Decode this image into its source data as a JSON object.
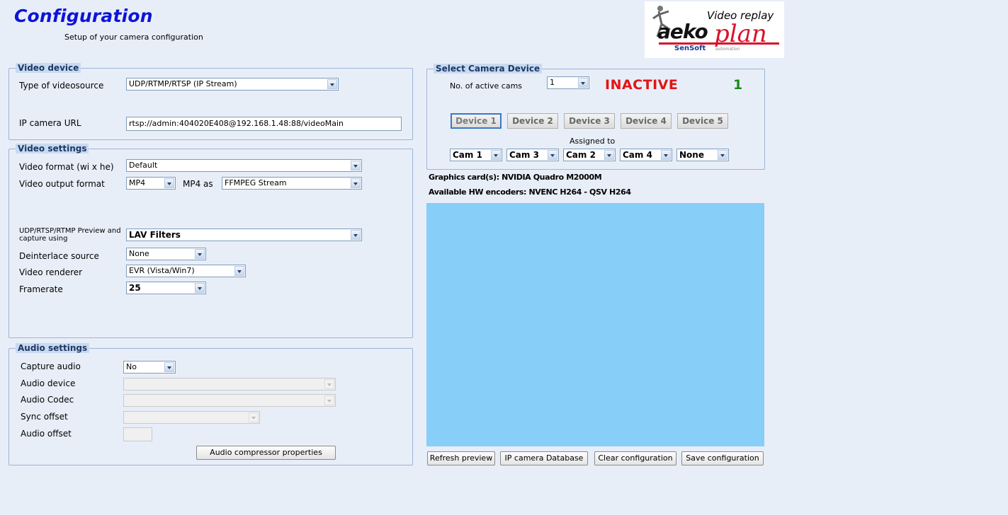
{
  "header": {
    "title": "Configuration",
    "subtitle": "Setup of your camera configuration"
  },
  "logo": {
    "title": "Video replay",
    "brand_a": "aeko",
    "brand_b": "plan",
    "sensoft": "SenSoft",
    "automation": "automation"
  },
  "video_device": {
    "group_label": "Video device",
    "type_label": "Type of videosource",
    "type_value": "UDP/RTMP/RTSP (IP Stream)",
    "url_label": "IP camera URL",
    "url_value": "rtsp://admin:404020E408@192.168.1.48:88/videoMain"
  },
  "video_settings": {
    "group_label": "Video settings",
    "format_label": "Video format (wi x he)",
    "format_value": "Default",
    "output_label": "Video output format",
    "output_value": "MP4",
    "mp4_as_label": "MP4 as",
    "mp4_as_value": "FFMPEG Stream",
    "preview_label_1": "UDP/RTSP/RTMP Preview and",
    "preview_label_2": "capture using",
    "preview_value": "LAV Filters",
    "deinterlace_label": "Deinterlace source",
    "deinterlace_value": "None",
    "renderer_label": "Video renderer",
    "renderer_value": "EVR (Vista/Win7)",
    "framerate_label": "Framerate",
    "framerate_value": "25"
  },
  "audio_settings": {
    "group_label": "Audio settings",
    "capture_label": "Capture audio",
    "capture_value": "No",
    "device_label": "Audio device",
    "codec_label": "Audio Codec",
    "sync_label": "Sync offset",
    "offset_label": "Audio offset",
    "compressor_button": "Audio compressor properties"
  },
  "camera_device": {
    "group_label": "Select Camera Device",
    "active_cams_label": "No. of active cams",
    "active_cams_value": "1",
    "status": "INACTIVE",
    "status_color": "#e01515",
    "count": "1",
    "count_color": "#1a8a1a",
    "devices": [
      "Device 1",
      "Device 2",
      "Device 3",
      "Device 4",
      "Device 5"
    ],
    "assigned_label": "Assigned to",
    "assignments": [
      "Cam 1",
      "Cam 3",
      "Cam 2",
      "Cam 4",
      "None"
    ]
  },
  "info": {
    "graphics": "Graphics card(s): NVIDIA Quadro M2000M",
    "encoders": "Available HW encoders: NVENC H264  - QSV H264"
  },
  "preview_color": "#87cef8",
  "actions": {
    "refresh": "Refresh preview",
    "database": "IP camera Database",
    "clear": "Clear configuration",
    "save": "Save configuration"
  }
}
